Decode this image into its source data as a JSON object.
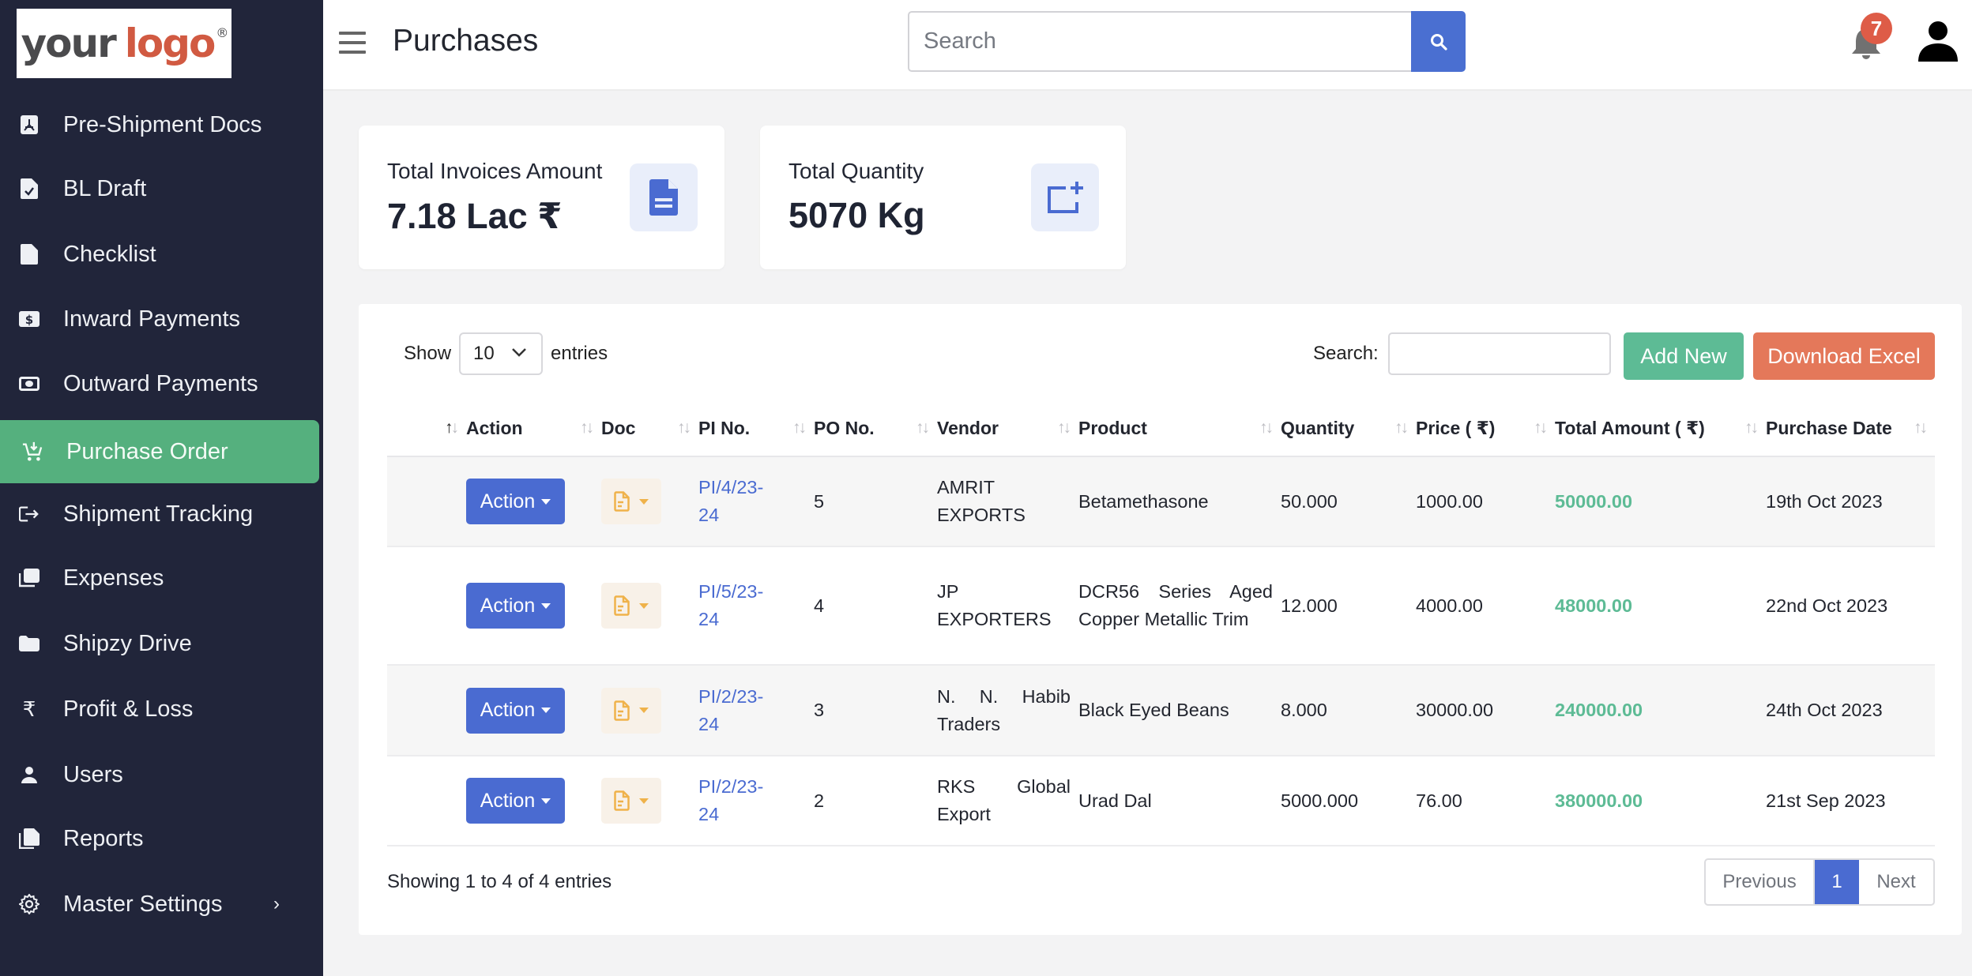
{
  "logo": {
    "word1": "your",
    "word2": "logo",
    "mark": "®"
  },
  "sidebar": {
    "items": [
      {
        "label": "Pre-Shipment Docs",
        "icon": "pdf-file-icon"
      },
      {
        "label": "BL Draft",
        "icon": "file-check-icon"
      },
      {
        "label": "Checklist",
        "icon": "file-icon"
      },
      {
        "label": "Inward Payments",
        "icon": "dollar-bill-icon"
      },
      {
        "label": "Outward Payments",
        "icon": "money-icon"
      },
      {
        "label": "Purchase Order",
        "icon": "cart-download-icon",
        "active": true
      },
      {
        "label": "Shipment Tracking",
        "icon": "sign-out-icon"
      },
      {
        "label": "Expenses",
        "icon": "copy-icon"
      },
      {
        "label": "Shipzy Drive",
        "icon": "folder-icon"
      },
      {
        "label": "Profit & Loss",
        "icon": "rupee-icon"
      },
      {
        "label": "Users",
        "icon": "user-icon"
      },
      {
        "label": "Reports",
        "icon": "files-icon"
      },
      {
        "label": "Master Settings",
        "icon": "gear-icon",
        "chevron": "›"
      }
    ]
  },
  "header": {
    "title": "Purchases",
    "search_placeholder": "Search",
    "notification_count": "7"
  },
  "cards": [
    {
      "label": "Total Invoices Amount",
      "value": "7.18 Lac ₹",
      "icon": "document-icon"
    },
    {
      "label": "Total Quantity",
      "value": "5070 Kg",
      "icon": "add-box-icon"
    }
  ],
  "table_controls": {
    "show_label": "Show",
    "entries_value": "10",
    "entries_label": "entries",
    "search_label": "Search:",
    "search_value": "",
    "add_new": "Add New",
    "download_excel": "Download Excel"
  },
  "colors": {
    "sidebar_bg": "#21253a",
    "active_green": "#55b07e",
    "primary_blue": "#4a6bd1",
    "add_green": "#5dbb95",
    "excel_orange": "#e4785a",
    "amount_green": "#5dbb95",
    "badge_red": "#de5c47"
  },
  "table": {
    "columns": [
      "",
      "Action",
      "Doc",
      "PI No.",
      "PO No.",
      "Vendor",
      "Product",
      "Quantity",
      "Price ( ₹)",
      "Total Amount ( ₹)",
      "Purchase Date"
    ],
    "rows": [
      {
        "action": "Action",
        "pi_no": "PI/4/23-24",
        "po_no": "5",
        "vendor": "AMRIT EXPORTS",
        "product": "Betamethasone",
        "quantity": "50.000",
        "price": "1000.00",
        "total": "50000.00",
        "date": "19th Oct 2023"
      },
      {
        "action": "Action",
        "pi_no": "PI/5/23-24",
        "po_no": "4",
        "vendor": "JP EXPORTERS",
        "product": "DCR56 Series Aged Copper Metallic Trim",
        "quantity": "12.000",
        "price": "4000.00",
        "total": "48000.00",
        "date": "22nd Oct 2023"
      },
      {
        "action": "Action",
        "pi_no": "PI/2/23-24",
        "po_no": "3",
        "vendor": "N. N. Habib Traders",
        "product": "Black Eyed Beans",
        "quantity": "8.000",
        "price": "30000.00",
        "total": "240000.00",
        "date": "24th Oct 2023"
      },
      {
        "action": "Action",
        "pi_no": "PI/2/23-24",
        "po_no": "2",
        "vendor": "RKS Global Export",
        "product": "Urad Dal",
        "quantity": "5000.000",
        "price": "76.00",
        "total": "380000.00",
        "date": "21st Sep 2023"
      }
    ]
  },
  "footer": {
    "info": "Showing 1 to 4 of 4 entries",
    "previous": "Previous",
    "current_page": "1",
    "next": "Next"
  }
}
